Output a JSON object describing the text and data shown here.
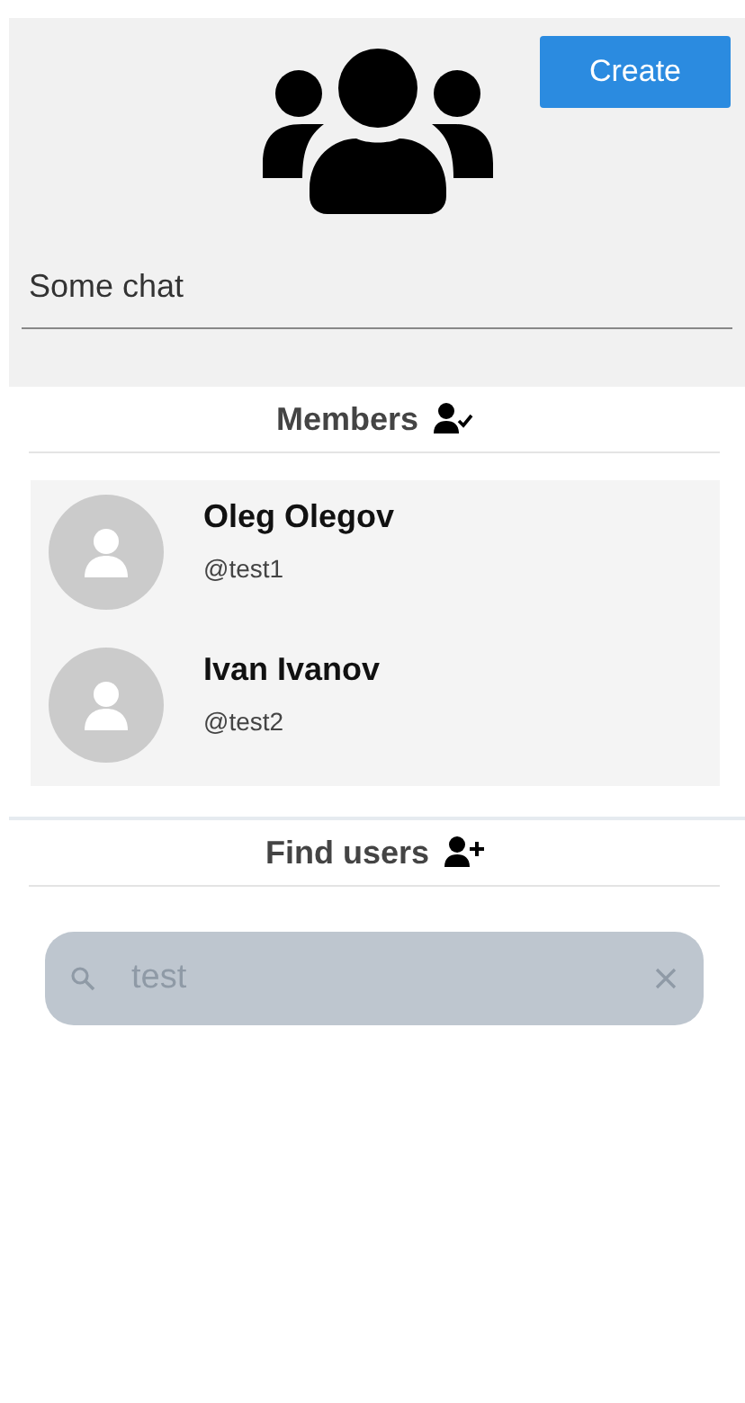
{
  "create_button": {
    "label": "Create"
  },
  "chat_name": {
    "value": "Some chat"
  },
  "members_header": {
    "label": "Members"
  },
  "members": [
    {
      "name": "Oleg Olegov",
      "username": "@test1"
    },
    {
      "name": "Ivan Ivanov",
      "username": "@test2"
    }
  ],
  "find_header": {
    "label": "Find users"
  },
  "search": {
    "value": "test"
  }
}
